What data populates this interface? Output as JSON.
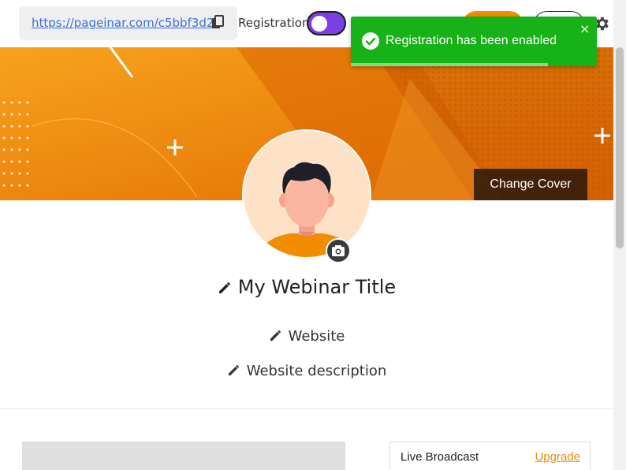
{
  "header": {
    "url": "https://pageinar.com/c5bbf3d2",
    "registration_label": "Registration",
    "registration_enabled": true
  },
  "cover": {
    "change_cover_label": "Change Cover"
  },
  "profile": {
    "title": "My Webinar Title",
    "website": "Website",
    "website_description": "Website description"
  },
  "sidebar_card": {
    "label": "Live Broadcast",
    "upgrade_label": "Upgrade"
  },
  "toast": {
    "message": "Registration has been enabled",
    "close_symbol": "×",
    "progress_fraction": 0.8
  },
  "colors": {
    "accent_orange": "#f28c00",
    "toggle_purple": "#7b3fe4",
    "toast_green": "#17b217",
    "link_blue": "#3b6fd4",
    "upgrade_orange": "#e88a10"
  },
  "icons": [
    "copy-icon",
    "gear-icon",
    "camera-icon",
    "pencil-icon",
    "check-circle-icon",
    "close-icon",
    "plus-icon"
  ]
}
